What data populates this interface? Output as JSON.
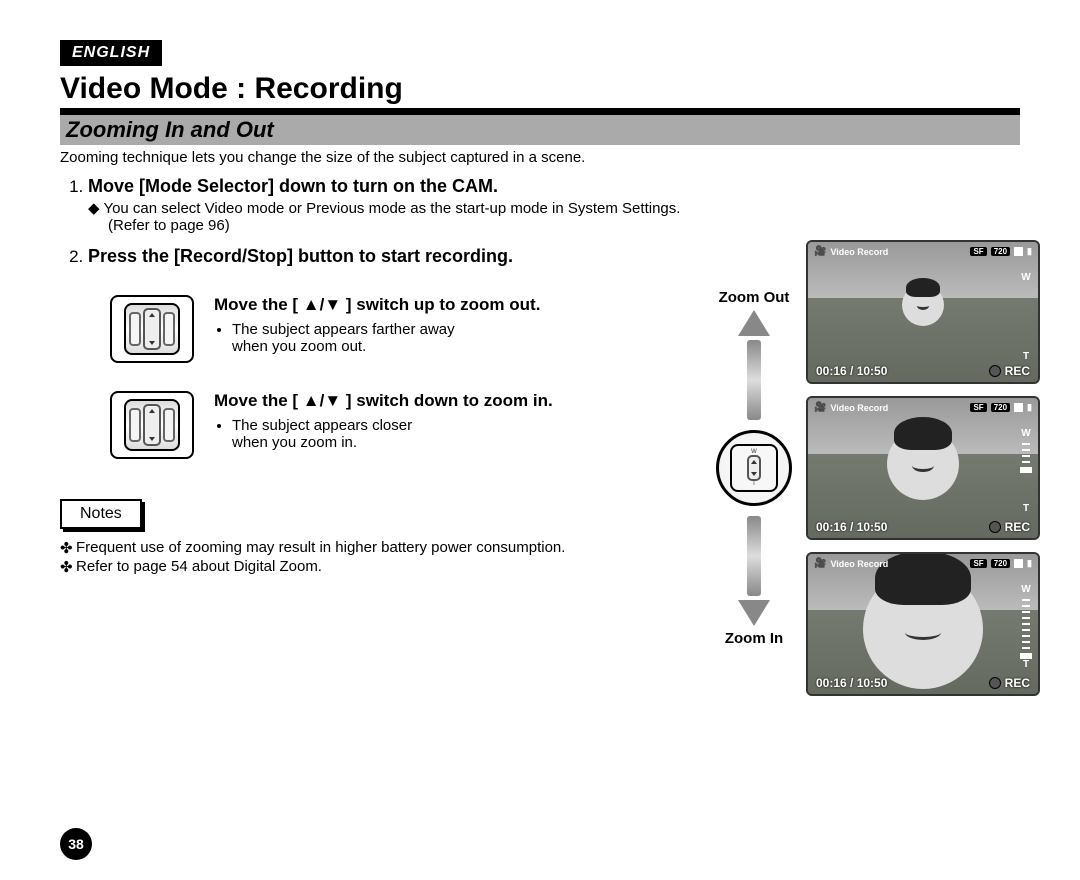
{
  "language": "ENGLISH",
  "title": "Video Mode : Recording",
  "subtitle": "Zooming In and Out",
  "intro": "Zooming technique lets you change the size of the subject captured in a scene.",
  "steps": {
    "s1_title": "Move [Mode Selector] down to turn on the CAM.",
    "s1_sub": "You can select Video mode or Previous mode as the start-up mode in System Settings.",
    "s1_sub2": "(Refer to page 96)",
    "s2_title": "Press the [Record/Stop] button to start recording."
  },
  "switch_up": {
    "title": "Move the [ ▲/▼ ] switch up to zoom out.",
    "bullet1": "The subject appears farther away",
    "bullet2": "when you zoom out."
  },
  "switch_down": {
    "title": "Move the [ ▲/▼ ] switch down to zoom in.",
    "bullet1": "The subject appears closer",
    "bullet2": "when you zoom in."
  },
  "zoom_labels": {
    "out": "Zoom Out",
    "in": "Zoom In"
  },
  "lcd": {
    "mode": "Video Record",
    "quality": "SF",
    "res": "720",
    "time": "00:16 / 10:50",
    "rec": "REC",
    "w": "W",
    "t": "T"
  },
  "notes_title": "Notes",
  "notes": {
    "n1": "Frequent use of zooming may result in higher battery power consumption.",
    "n2": "Refer to page 54 about Digital Zoom."
  },
  "page_number": "38"
}
